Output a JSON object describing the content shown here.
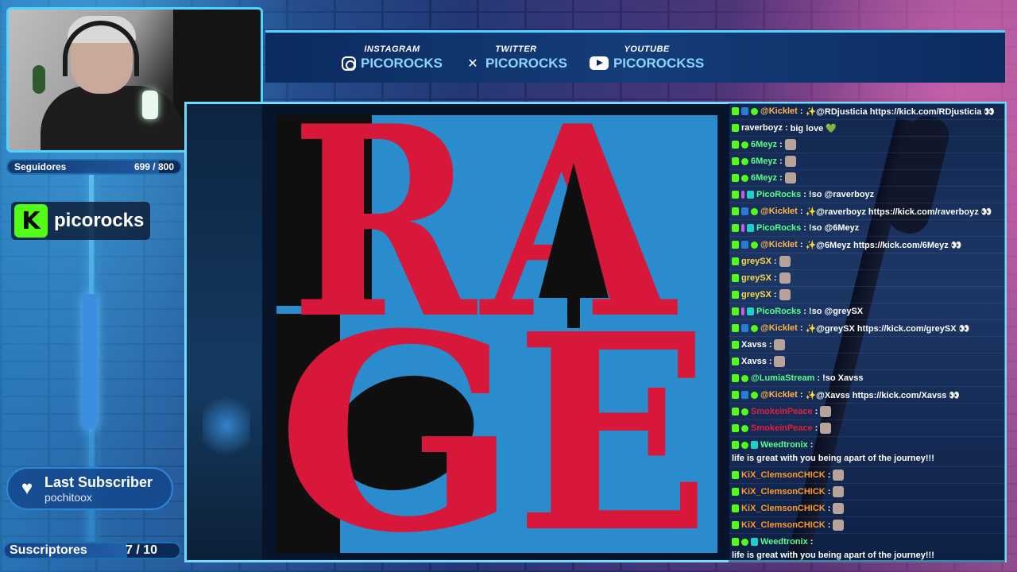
{
  "colors": {
    "accent": "#4fd3ff",
    "kick_green": "#53fc18",
    "album_red": "#d8183a",
    "album_blue": "#2a8ccc"
  },
  "goal": {
    "label": "Seguidores",
    "value": "699 / 800",
    "progress": 0.874
  },
  "brand": {
    "logo_letter": "K",
    "name": "picorocks"
  },
  "last_subscriber": {
    "title": "Last Subscriber",
    "name": "pochitoox"
  },
  "subs": {
    "label": "Suscriptores",
    "value": "7 / 10",
    "progress": 0.7
  },
  "socials": [
    {
      "label": "INSTAGRAM",
      "handle": "PICOROCKS",
      "icon": "instagram-icon"
    },
    {
      "label": "TWITTER",
      "handle": "PICOROCKS",
      "icon": "x-icon"
    },
    {
      "label": "YOUTUBE",
      "handle": "PICOROCKSS",
      "icon": "youtube-icon"
    }
  ],
  "album": {
    "letters": [
      "R",
      "A",
      "G",
      "E"
    ]
  },
  "chat": [
    {
      "user": "@Kicklet",
      "color": "#ffb54a",
      "badges": [
        "kick",
        "bot",
        "verified"
      ],
      "msg": "✨@RDjusticia https://kick.com/RDjusticia 👀"
    },
    {
      "user": "raverboyz",
      "color": "#ffffff",
      "badges": [
        "kick"
      ],
      "msg": "big love 💚"
    },
    {
      "user": "6Meyz",
      "color": "#58ff8a",
      "badges": [
        "kick",
        "verified"
      ],
      "msg": "",
      "emote": true
    },
    {
      "user": "6Meyz",
      "color": "#58ff8a",
      "badges": [
        "kick",
        "verified"
      ],
      "msg": "",
      "emote": true
    },
    {
      "user": "6Meyz",
      "color": "#58ff8a",
      "badges": [
        "kick",
        "verified"
      ],
      "msg": "",
      "emote": true
    },
    {
      "user": "PicoRocks",
      "color": "#58ff8a",
      "badges": [
        "kick",
        "pink",
        "cyan"
      ],
      "msg": "!so @raverboyz"
    },
    {
      "user": "@Kicklet",
      "color": "#ffb54a",
      "badges": [
        "kick",
        "bot",
        "verified"
      ],
      "msg": "✨@raverboyz https://kick.com/raverboyz 👀"
    },
    {
      "user": "PicoRocks",
      "color": "#58ff8a",
      "badges": [
        "kick",
        "pink",
        "cyan"
      ],
      "msg": "!so @6Meyz"
    },
    {
      "user": "@Kicklet",
      "color": "#ffb54a",
      "badges": [
        "kick",
        "bot",
        "verified"
      ],
      "msg": "✨@6Meyz https://kick.com/6Meyz 👀"
    },
    {
      "user": "greySX",
      "color": "#ffd94a",
      "badges": [
        "kick"
      ],
      "msg": "",
      "emote": true
    },
    {
      "user": "greySX",
      "color": "#ffd94a",
      "badges": [
        "kick"
      ],
      "msg": "",
      "emote": true
    },
    {
      "user": "greySX",
      "color": "#ffd94a",
      "badges": [
        "kick"
      ],
      "msg": "",
      "emote": true
    },
    {
      "user": "PicoRocks",
      "color": "#58ff8a",
      "badges": [
        "kick",
        "pink",
        "cyan"
      ],
      "msg": "!so @greySX"
    },
    {
      "user": "@Kicklet",
      "color": "#ffb54a",
      "badges": [
        "kick",
        "bot",
        "verified"
      ],
      "msg": "✨@greySX https://kick.com/greySX 👀"
    },
    {
      "user": "Xavss",
      "color": "#ffffff",
      "badges": [
        "kick"
      ],
      "msg": "",
      "emote": true
    },
    {
      "user": "Xavss",
      "color": "#ffffff",
      "badges": [
        "kick"
      ],
      "msg": "",
      "emote": true
    },
    {
      "user": "@LumiaStream",
      "color": "#58ff8a",
      "badges": [
        "kick",
        "verified"
      ],
      "msg": "!so Xavss"
    },
    {
      "user": "@Kicklet",
      "color": "#ffb54a",
      "badges": [
        "kick",
        "bot",
        "verified"
      ],
      "msg": "✨@Xavss https://kick.com/Xavss 👀"
    },
    {
      "user": "SmokeinPeace",
      "color": "#e0203a",
      "badges": [
        "kick",
        "verified"
      ],
      "msg": "",
      "emote": true
    },
    {
      "user": "SmokeinPeace",
      "color": "#e0203a",
      "badges": [
        "kick",
        "verified"
      ],
      "msg": "",
      "emote": true
    },
    {
      "user": "Weedtronix",
      "color": "#58ff8a",
      "badges": [
        "kick",
        "verified",
        "cyan"
      ],
      "msg": "life is great with you being apart of the journey!!!",
      "tall": true
    },
    {
      "user": "KiX_ClemsonCHICK",
      "color": "#ff9a2a",
      "badges": [
        "kick"
      ],
      "msg": "",
      "emote": true
    },
    {
      "user": "KiX_ClemsonCHICK",
      "color": "#ff9a2a",
      "badges": [
        "kick"
      ],
      "msg": "",
      "emote": true
    },
    {
      "user": "KiX_ClemsonCHICK",
      "color": "#ff9a2a",
      "badges": [
        "kick"
      ],
      "msg": "",
      "emote": true
    },
    {
      "user": "KiX_ClemsonCHICK",
      "color": "#ff9a2a",
      "badges": [
        "kick"
      ],
      "msg": "",
      "emote": true
    },
    {
      "user": "Weedtronix",
      "color": "#58ff8a",
      "badges": [
        "kick",
        "verified",
        "cyan"
      ],
      "msg": "life is great with you being apart of the journey!!!",
      "tall": true
    }
  ]
}
